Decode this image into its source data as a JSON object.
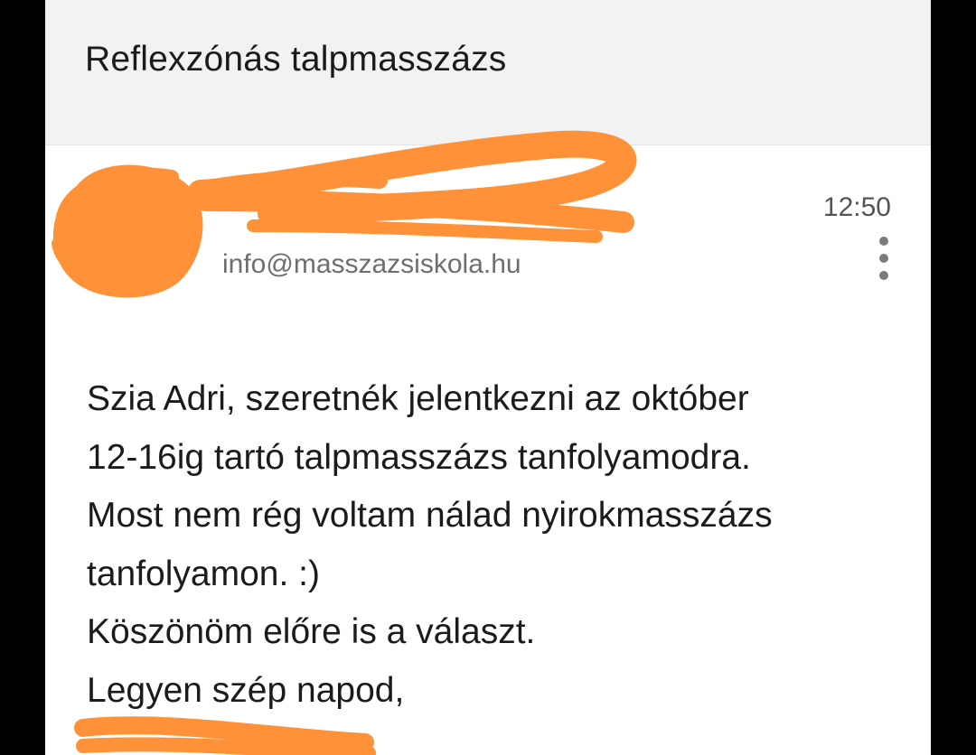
{
  "email": {
    "subject": "Reflexzónás talpmasszázs",
    "sender": {
      "name": "",
      "email": "info@masszazsiskola.hu",
      "time": "12:50"
    },
    "body_lines": [
      "Szia Adri, szeretnék jelentkezni az október",
      "12-16ig tartó talpmasszázs tanfolyamodra.",
      "Most nem rég voltam nálad nyirokmasszázs",
      "tanfolyamon. :)",
      "Köszönöm előre is a választ.",
      "Legyen szép napod,"
    ],
    "signature": ""
  },
  "colors": {
    "redaction": "#ff9138",
    "header_bg": "#f2f2f2",
    "text": "#1b1b1b",
    "muted": "#6e6e6e"
  },
  "icons": {
    "more": "more-vertical-icon"
  }
}
